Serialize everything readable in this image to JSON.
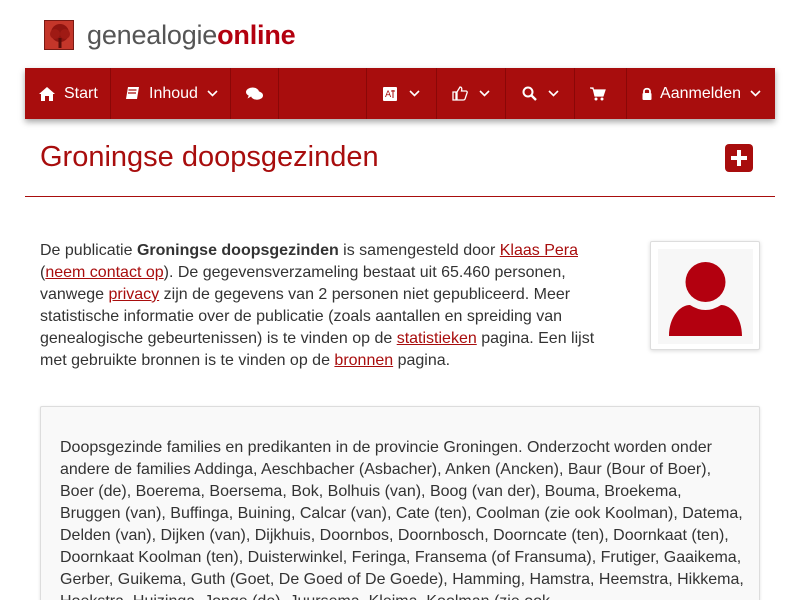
{
  "brand": {
    "name_part1": "genealogie",
    "name_part2": "online"
  },
  "nav": {
    "start_label": "Start",
    "inhoud_label": "Inhoud",
    "aanmelden_label": "Aanmelden"
  },
  "page": {
    "title": "Groningse doopsgezinden"
  },
  "intro": {
    "t1": "De publicatie ",
    "pub_name": "Groningse doopsgezinden",
    "t2": " is samengesteld door ",
    "author": "Klaas Pera",
    "t3": " (",
    "contact": "neem contact op",
    "t4": "). De gegevensverzameling bestaat uit 65.460 personen, vanwege ",
    "privacy": "privacy",
    "t5": " zijn de gegevens van 2 personen niet gepubliceerd. Meer statistische informatie over de publicatie (zoals aantallen en spreiding van genealogische gebeurtenissen) is te vinden op de ",
    "statistieken": "statistieken",
    "t6": " pagina. Een lijst met gebruikte bronnen is te vinden op de ",
    "bronnen": "bronnen",
    "t7": " pagina."
  },
  "description": "Doopsgezinde families en predikanten in de provincie Groningen. Onderzocht worden onder andere de families Addinga, Aeschbacher (Asbacher), Anken (Ancken), Baur (Bour of Boer), Boer (de), Boerema, Boersema, Bok, Bolhuis (van), Boog (van der), Bouma, Broekema, Bruggen (van), Buffinga, Buining, Calcar (van), Cate (ten), Coolman (zie ook Koolman), Datema, Delden (van), Dijken (van), Dijkhuis, Doornbos, Doornbosch, Doorncate (ten), Doornkaat (ten), Doornkaat Koolman (ten), Duisterwinkel, Feringa, Fransema (of Fransuma), Frutiger, Gaaikema, Gerber, Guikema, Guth (Goet, De Goed of De Goede), Hamming, Hamstra, Heemstra, Hikkema, Hoekstra, Huizinga, Jonge (de), Juursema, Kleima, Koolman (zie ook",
  "colors": {
    "brand_red": "#a80d0d",
    "link": "#a80d0d"
  },
  "icons": {
    "start": "home-icon",
    "inhoud": "book-icon",
    "chat": "comments-icon",
    "language": "language-icon",
    "thumbs": "thumbs-up-icon",
    "search": "search-icon",
    "cart": "cart-icon",
    "lock": "lock-icon",
    "add": "plus-square-icon",
    "avatar": "user-icon"
  }
}
